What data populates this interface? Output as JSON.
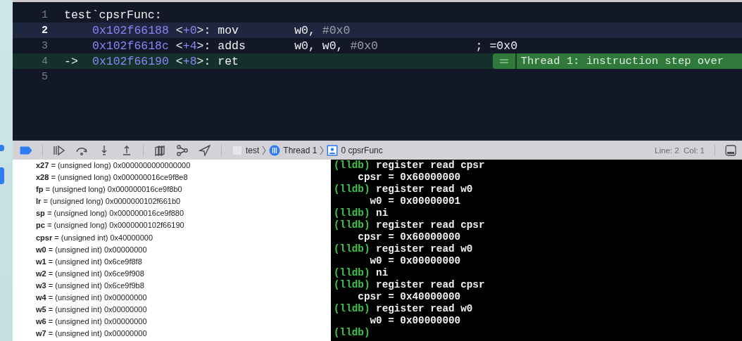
{
  "editor": {
    "lines": [
      {
        "number": "1",
        "kind": "label",
        "current": false,
        "pc": false,
        "tokens": [
          {
            "kind": "plain",
            "text": "test`cpsrFunc:"
          }
        ]
      },
      {
        "number": "2",
        "kind": "instruction",
        "current": true,
        "pc": false,
        "tokens": [
          {
            "kind": "addr",
            "text": "0x102f66188"
          },
          {
            "kind": "plain",
            "text": " <"
          },
          {
            "kind": "addr",
            "text": "+0"
          },
          {
            "kind": "plain",
            "text": ">: mov        w0, "
          },
          {
            "kind": "imm",
            "text": "#0x0"
          }
        ]
      },
      {
        "number": "3",
        "kind": "instruction",
        "current": false,
        "pc": false,
        "tokens": [
          {
            "kind": "addr",
            "text": "0x102f6618c"
          },
          {
            "kind": "plain",
            "text": " <"
          },
          {
            "kind": "addr",
            "text": "+4"
          },
          {
            "kind": "plain",
            "text": ">: adds       w0, w0, "
          },
          {
            "kind": "imm",
            "text": "#0x0"
          },
          {
            "kind": "plain",
            "text": "              ; =0x0"
          }
        ]
      },
      {
        "number": "4",
        "kind": "instruction",
        "current": false,
        "pc": true,
        "arrow": "->",
        "tokens": [
          {
            "kind": "addr",
            "text": "0x102f66190"
          },
          {
            "kind": "plain",
            "text": " <"
          },
          {
            "kind": "addr",
            "text": "+8"
          },
          {
            "kind": "plain",
            "text": ">: ret"
          }
        ],
        "badge": "Thread 1: instruction step over"
      },
      {
        "number": "5",
        "kind": "empty",
        "current": false,
        "pc": false
      }
    ]
  },
  "debug_bar": {
    "breakpoints_active": true,
    "breadcrumb": [
      {
        "kind": "app",
        "label": "test"
      },
      {
        "kind": "thread",
        "label": "Thread 1"
      },
      {
        "kind": "frame",
        "label": "0 cpsrFunc"
      }
    ],
    "position": "Line: 2  Col: 1"
  },
  "variables": [
    {
      "name": "x27",
      "value": "= (unsigned long) 0x0000000000000000"
    },
    {
      "name": "x28",
      "value": "= (unsigned long) 0x000000016ce9f8e8"
    },
    {
      "name": "fp",
      "value": "= (unsigned long) 0x000000016ce9f8b0"
    },
    {
      "name": "lr",
      "value": "= (unsigned long) 0x0000000102f661b0"
    },
    {
      "name": "sp",
      "value": "= (unsigned long) 0x000000016ce9f880"
    },
    {
      "name": "pc",
      "value": "= (unsigned long) 0x0000000102f66190"
    },
    {
      "name": "cpsr",
      "value": "= (unsigned int) 0x40000000"
    },
    {
      "name": "w0",
      "value": "= (unsigned int) 0x00000000"
    },
    {
      "name": "w1",
      "value": "= (unsigned int) 0x6ce9f8f8"
    },
    {
      "name": "w2",
      "value": "= (unsigned int) 0x6ce9f908"
    },
    {
      "name": "w3",
      "value": "= (unsigned int) 0x6ce9f9b8"
    },
    {
      "name": "w4",
      "value": "= (unsigned int) 0x00000000"
    },
    {
      "name": "w5",
      "value": "= (unsigned int) 0x00000000"
    },
    {
      "name": "w6",
      "value": "= (unsigned int) 0x00000000"
    },
    {
      "name": "w7",
      "value": "= (unsigned int) 0x00000000"
    }
  ],
  "console": [
    {
      "kind": "command",
      "prompt": "(lldb)",
      "text": "register read cpsr"
    },
    {
      "kind": "output",
      "text": "    cpsr = 0x60000000"
    },
    {
      "kind": "command",
      "prompt": "(lldb)",
      "text": "register read w0"
    },
    {
      "kind": "output",
      "text": "      w0 = 0x00000001"
    },
    {
      "kind": "command",
      "prompt": "(lldb)",
      "text": "ni"
    },
    {
      "kind": "command",
      "prompt": "(lldb)",
      "text": "register read cpsr"
    },
    {
      "kind": "output",
      "text": "    cpsr = 0x60000000"
    },
    {
      "kind": "command",
      "prompt": "(lldb)",
      "text": "register read w0"
    },
    {
      "kind": "output",
      "text": "      w0 = 0x00000000"
    },
    {
      "kind": "command",
      "prompt": "(lldb)",
      "text": "ni"
    },
    {
      "kind": "command",
      "prompt": "(lldb)",
      "text": "register read cpsr"
    },
    {
      "kind": "output",
      "text": "    cpsr = 0x40000000"
    },
    {
      "kind": "command",
      "prompt": "(lldb)",
      "text": "register read w0"
    },
    {
      "kind": "output",
      "text": "      w0 = 0x00000000"
    },
    {
      "kind": "command",
      "prompt": "(lldb)"
    }
  ]
}
